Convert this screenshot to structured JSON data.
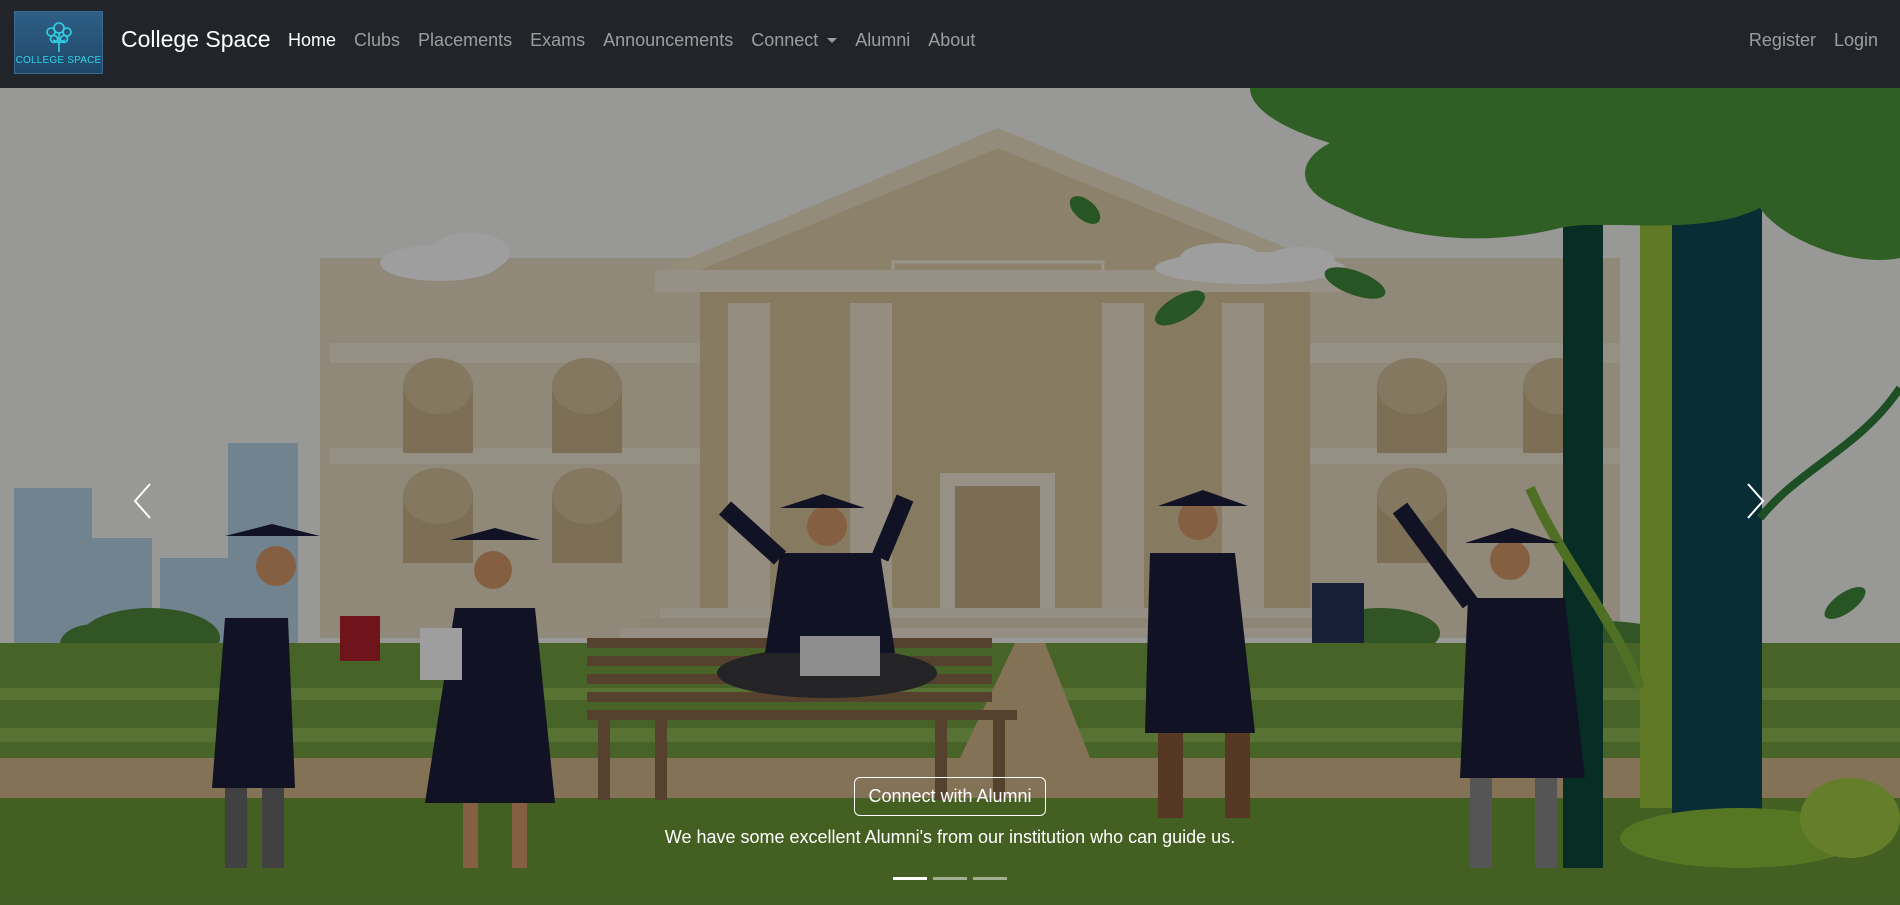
{
  "navbar": {
    "logo_text": "COLLEGE SPACE",
    "brand": "College Space",
    "links": [
      {
        "label": "Home"
      },
      {
        "label": "Clubs"
      },
      {
        "label": "Placements"
      },
      {
        "label": "Exams"
      },
      {
        "label": "Announcements"
      },
      {
        "label": "Connect"
      },
      {
        "label": "Alumni"
      },
      {
        "label": "About"
      }
    ],
    "right_links": [
      {
        "label": "Register"
      },
      {
        "label": "Login"
      }
    ],
    "active_link": "Home"
  },
  "carousel": {
    "caption_button": "Connect with Alumni",
    "caption_text": "We have some excellent Alumni's from our institution who can guide us.",
    "slide_count": 3,
    "active_slide": 1,
    "prev_icon": "chevron-left-icon",
    "next_icon": "chevron-right-icon"
  },
  "colors": {
    "navbar_bg": "#212529",
    "logo_accent": "#33d1e6",
    "gown": "#1c1f3a",
    "grass": "#5b7a32"
  }
}
